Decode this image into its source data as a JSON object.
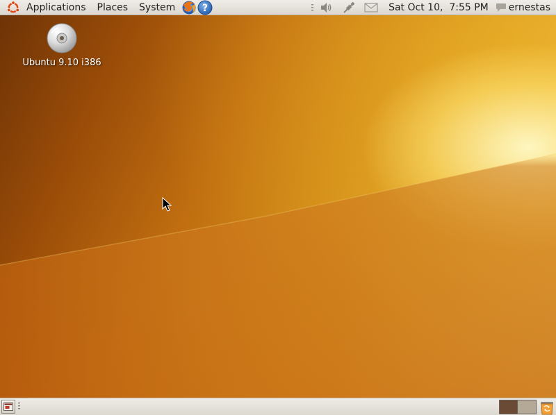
{
  "top_panel": {
    "menus": {
      "applications": "Applications",
      "places": "Places",
      "system": "System"
    },
    "launchers": [
      "firefox-icon",
      "help-icon"
    ],
    "tray": [
      "volume-icon",
      "network-icon",
      "mail-icon"
    ],
    "clock": "Sat Oct 10,  7:55 PM",
    "user": "ernestas"
  },
  "desktop": {
    "icons": [
      {
        "label": "Ubuntu 9.10 i386",
        "icon": "cd-icon"
      }
    ]
  },
  "bottom_panel": {
    "workspaces": [
      {
        "name": "workspace-1",
        "active": true,
        "color": "#6b4a35"
      },
      {
        "name": "workspace-2",
        "active": false,
        "color": "#b4a996"
      }
    ],
    "trash_icon": "trash-icon"
  },
  "colors": {
    "panel": "#e6e2db",
    "ubuntu_orange": "#dd4814"
  }
}
